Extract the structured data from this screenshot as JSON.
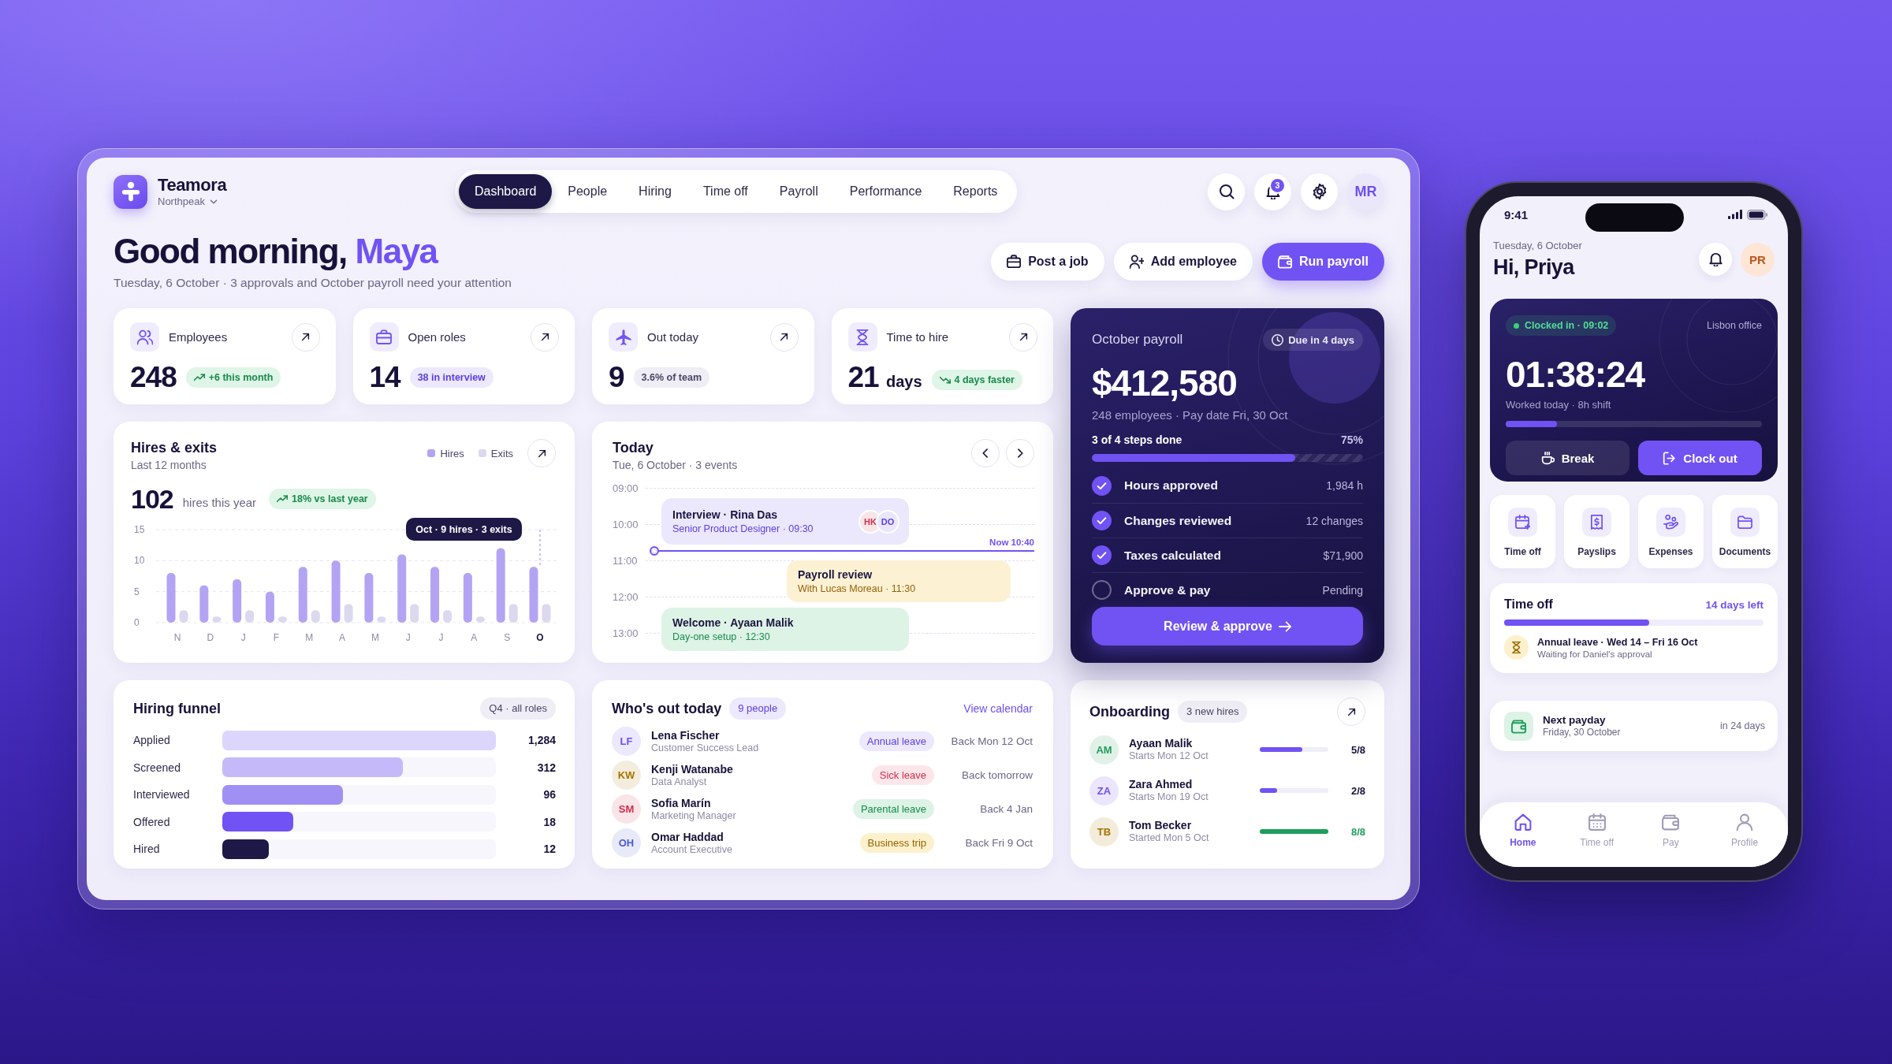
{
  "dashboard": {
    "brand": {
      "name": "Teamora",
      "workspace": "Northpeak"
    },
    "nav": [
      {
        "label": "Dashboard",
        "selected": true
      },
      {
        "label": "People",
        "selected": false
      },
      {
        "label": "Hiring",
        "selected": false
      },
      {
        "label": "Time off",
        "selected": false
      },
      {
        "label": "Payroll",
        "selected": false
      },
      {
        "label": "Performance",
        "selected": false
      },
      {
        "label": "Reports",
        "selected": false
      }
    ],
    "header": {
      "notifications": "3",
      "avatar": "MR"
    },
    "greeting": {
      "text": "Good morning,",
      "name": "Maya",
      "subtitle": "Tuesday, 6 October · 3 approvals and October payroll need your attention"
    },
    "actions": [
      {
        "label": "Post a job",
        "kind": "secondary"
      },
      {
        "label": "Add employee",
        "kind": "secondary"
      },
      {
        "label": "Run payroll",
        "kind": "primary"
      }
    ],
    "kpis": [
      {
        "label": "Employees",
        "value": "248",
        "badge": {
          "text": "+6 this month",
          "kind": "up"
        }
      },
      {
        "label": "Open roles",
        "value": "14",
        "badge": {
          "text": "38 in interview",
          "kind": "accent"
        }
      },
      {
        "label": "Out today",
        "value": "9",
        "badge": {
          "text": "3.6% of team",
          "kind": "neutral"
        }
      },
      {
        "label": "Time to hire",
        "value": "21",
        "unit": "days",
        "badge": {
          "text": "4 days faster",
          "kind": "down"
        }
      }
    ],
    "payroll": {
      "title": "October payroll",
      "due": "Due in 4 days",
      "amount": "$412,580",
      "meta": "248 employees · Pay date Fri, 30 Oct",
      "progress_label": "3 of 4 steps done",
      "progress_text": "75%",
      "level": 0.75,
      "steps": [
        {
          "label": "Hours approved",
          "value": "1,984 h",
          "checked": true
        },
        {
          "label": "Changes reviewed",
          "value": "12 changes",
          "checked": true
        },
        {
          "label": "Taxes calculated",
          "value": "$71,900",
          "checked": true
        },
        {
          "label": "Approve & pay",
          "value": "Pending",
          "checked": false
        }
      ],
      "button": "Review & approve"
    },
    "hires_exits": {
      "title": "Hires & exits",
      "subtitle": "Last 12 months",
      "total": "102",
      "total_label": "hires this year",
      "badge": {
        "text": "18% vs last year",
        "kind": "up"
      },
      "chart_data": {
        "type": "bar",
        "categories": [
          "N",
          "D",
          "J",
          "F",
          "M",
          "A",
          "M",
          "J",
          "J",
          "A",
          "S",
          "O"
        ],
        "series": [
          {
            "name": "Hires",
            "color": "#b3a4f3",
            "values": [
              8,
              6,
              7,
              5,
              9,
              10,
              8,
              11,
              9,
              8,
              12,
              9
            ]
          },
          {
            "name": "Exits",
            "color": "#dcd8ef",
            "values": [
              2,
              1,
              2,
              1,
              2,
              3,
              1,
              3,
              2,
              1,
              3,
              3
            ]
          }
        ],
        "ylim": [
          0,
          15
        ],
        "yticks": [
          0,
          5,
          10,
          15
        ],
        "annotations": [
          "Oct · 9 hires · 3 exits"
        ]
      }
    },
    "today": {
      "title": "Today",
      "subtitle": "Tue, 6 October · 3 events",
      "hours": [
        "09:00",
        "10:00",
        "11:00",
        "12:00",
        "13:00"
      ],
      "now_label": "Now 10:40",
      "events": [
        {
          "kind": "interview",
          "title": "Interview · Rina Das",
          "detail": "Senior Product Designer · 09:30",
          "attendees": [
            {
              "initials": "HK",
              "color": "#d0304b"
            },
            {
              "initials": "DO",
              "color": "#5b3fe0"
            }
          ]
        },
        {
          "kind": "meeting",
          "title": "Payroll review",
          "detail": "With Lucas Moreau · 11:30"
        },
        {
          "kind": "onboarding",
          "title": "Welcome · Ayaan Malik",
          "detail": "Day-one setup · 12:30"
        }
      ]
    },
    "hiring_funnel": {
      "title": "Hiring funnel",
      "filter": "Q4 · all roles",
      "stages": [
        {
          "label": "Applied",
          "value": "1,284",
          "level": 1,
          "color": "#dcd5fc"
        },
        {
          "label": "Screened",
          "value": "312",
          "level": 0.66,
          "color": "#c5b9f9"
        },
        {
          "label": "Interviewed",
          "value": "96",
          "level": 0.44,
          "color": "#a090f4"
        },
        {
          "label": "Offered",
          "value": "18",
          "level": 0.26,
          "color": "#7152f3"
        },
        {
          "label": "Hired",
          "value": "12",
          "level": 0.17,
          "color": "#1e1846"
        }
      ]
    },
    "whos_out": {
      "title": "Who's out today",
      "count": "9 people",
      "link": "View calendar",
      "people": [
        {
          "initials": "LF",
          "name": "Lena Fischer",
          "role": "Customer Success Lead",
          "color": "#6d4ff0",
          "leave": "Annual leave",
          "kind": "annual",
          "back": "Back Mon 12 Oct"
        },
        {
          "initials": "KW",
          "name": "Kenji Watanabe",
          "role": "Data Analyst",
          "color": "#a87400",
          "leave": "Sick leave",
          "kind": "sick",
          "back": "Back tomorrow"
        },
        {
          "initials": "SM",
          "name": "Sofia Marín",
          "role": "Marketing Manager",
          "color": "#d0304b",
          "leave": "Parental leave",
          "kind": "parental",
          "back": "Back 4 Jan"
        },
        {
          "initials": "OH",
          "name": "Omar Haddad",
          "role": "Account Executive",
          "color": "#4b5bd0",
          "leave": "Business trip",
          "kind": "trip",
          "back": "Back Fri 9 Oct"
        }
      ]
    },
    "onboarding": {
      "title": "Onboarding",
      "count": "3 new hires",
      "hires": [
        {
          "initials": "AM",
          "name": "Ayaan Malik",
          "start": "Starts Mon 12 Oct",
          "color": "#1f9d5c",
          "progress": "5/8",
          "level": 0.625,
          "complete": false
        },
        {
          "initials": "ZA",
          "name": "Zara Ahmed",
          "start": "Starts Mon 19 Oct",
          "color": "#6d4ff0",
          "progress": "2/8",
          "level": 0.25,
          "complete": false
        },
        {
          "initials": "TB",
          "name": "Tom Becker",
          "start": "Started Mon 5 Oct",
          "color": "#a87400",
          "progress": "8/8",
          "level": 1,
          "complete": true
        }
      ]
    }
  },
  "phone": {
    "status_time": "9:41",
    "date": "Tuesday, 6 October",
    "greeting": "Hi, Priya",
    "avatar": "PR",
    "clock": {
      "status": "Clocked in · 09:02",
      "location": "Lisbon office",
      "elapsed": "01:38:24",
      "caption": "Worked today · 8h shift",
      "level": 0.2,
      "buttons": [
        {
          "label": "Break",
          "kind": "secondary"
        },
        {
          "label": "Clock out",
          "kind": "primary"
        }
      ]
    },
    "shortcuts": [
      "Time off",
      "Payslips",
      "Expenses",
      "Documents"
    ],
    "time_off": {
      "title": "Time off",
      "balance": "14 days left",
      "level": 0.56,
      "request": {
        "title": "Annual leave · Wed 14 – Fri 16 Oct",
        "status": "Waiting for Daniel's approval"
      }
    },
    "payday": {
      "title": "Next payday",
      "date": "Friday, 30 October",
      "countdown": "in 24 days"
    },
    "tabs": [
      {
        "label": "Home",
        "selected": true
      },
      {
        "label": "Time off",
        "selected": false
      },
      {
        "label": "Pay",
        "selected": false
      },
      {
        "label": "Profile",
        "selected": false
      }
    ]
  }
}
